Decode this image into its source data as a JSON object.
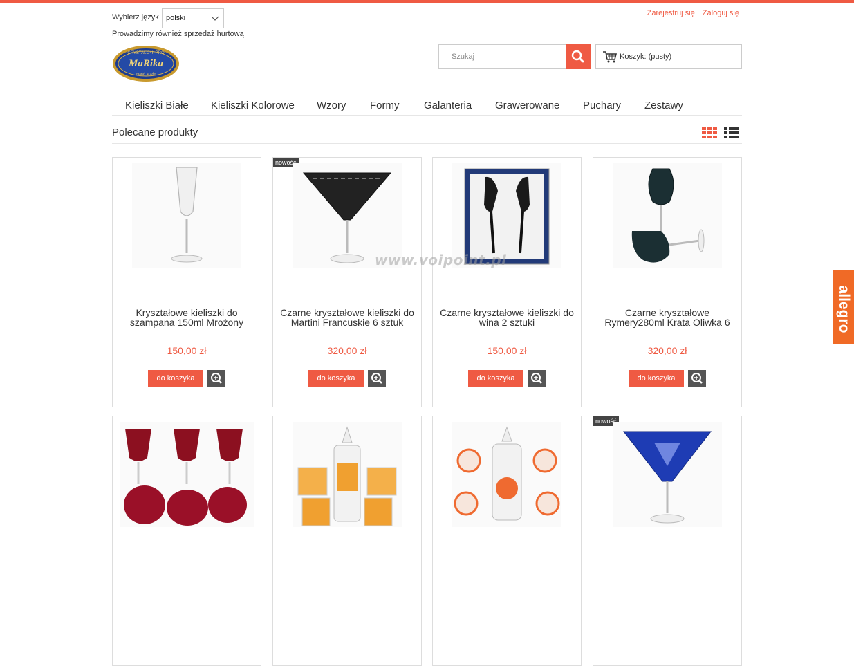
{
  "header": {
    "lang_label": "Wybierz język",
    "lang_value": "polski",
    "wholesale": "Prowadzimy również sprzedaż hurtową",
    "register": "Zarejestruj się",
    "login": "Zaloguj się",
    "logo_top": "CRYSTAL 24h PRO",
    "logo_main": "MaRika",
    "logo_bottom": "Hand Made",
    "search_placeholder": "Szukaj",
    "cart_label": "Koszyk: (pusty)"
  },
  "nav": [
    "Kieliszki Białe",
    "Kieliszki Kolorowe",
    "Wzory",
    "Formy",
    "Galanteria",
    "Grawerowane",
    "Puchary",
    "Zestawy"
  ],
  "section_title": "Polecane produkty",
  "products": [
    {
      "name": "Kryształowe kieliszki do szampana 150ml Mrożony",
      "price": "150,00 zł",
      "add": "do koszyka",
      "badge": ""
    },
    {
      "name": "Czarne kryształowe kieliszki do Martini Francuskie 6 sztuk",
      "price": "320,00 zł",
      "add": "do koszyka",
      "badge": "nowość"
    },
    {
      "name": "Czarne kryształowe kieliszki do wina 2 sztuki",
      "price": "150,00 zł",
      "add": "do koszyka",
      "badge": ""
    },
    {
      "name": "Czarne kryształowe Rymery280ml Krata Oliwka 6",
      "price": "320,00 zł",
      "add": "do koszyka",
      "badge": ""
    },
    {
      "badge": ""
    },
    {
      "badge": ""
    },
    {
      "badge": ""
    },
    {
      "badge": "nowość"
    }
  ],
  "watermark": "www.voipoint.pl",
  "allegro": "allegro",
  "colors": {
    "accent": "#ef5a43",
    "allegro": "#f06a26",
    "icon_dark": "#555555"
  }
}
